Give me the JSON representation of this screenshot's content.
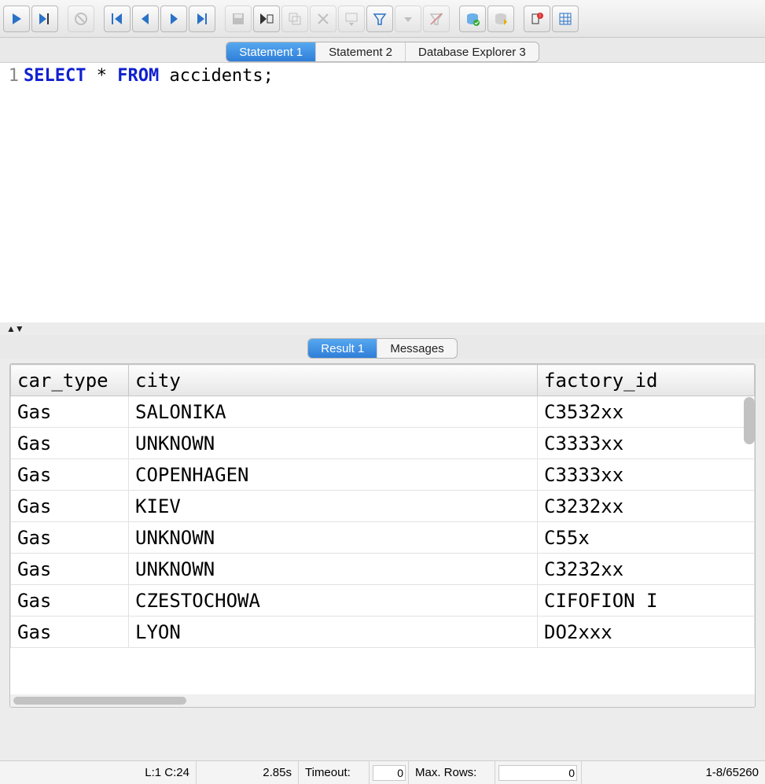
{
  "tabs": {
    "editor": [
      {
        "label": "Statement 1",
        "active": true
      },
      {
        "label": "Statement 2",
        "active": false
      },
      {
        "label": "Database Explorer 3",
        "active": false
      }
    ],
    "result": [
      {
        "label": "Result 1",
        "active": true
      },
      {
        "label": "Messages",
        "active": false
      }
    ]
  },
  "editor": {
    "line_number": "1",
    "sql_select": "SELECT",
    "sql_star": " * ",
    "sql_from": "FROM",
    "sql_rest": " accidents;"
  },
  "results": {
    "columns": [
      "car_type",
      "city",
      "factory_id"
    ],
    "rows": [
      [
        "Gas",
        "SALONIKA",
        "C3532xx"
      ],
      [
        "Gas",
        "UNKNOWN",
        "C3333xx"
      ],
      [
        "Gas",
        "COPENHAGEN",
        "C3333xx"
      ],
      [
        "Gas",
        "KIEV",
        "C3232xx"
      ],
      [
        "Gas",
        "UNKNOWN",
        "C55x"
      ],
      [
        "Gas",
        "UNKNOWN",
        "C3232xx"
      ],
      [
        "Gas",
        "CZESTOCHOWA",
        "CIFOFION I"
      ],
      [
        "Gas",
        "LYON",
        "DO2xxx"
      ]
    ]
  },
  "status": {
    "cursor": "L:1 C:24",
    "elapsed": "2.85s",
    "timeout_label": "Timeout:",
    "timeout_value": "0",
    "maxrows_label": "Max. Rows:",
    "maxrows_value": "0",
    "range": "1-8/65260"
  }
}
